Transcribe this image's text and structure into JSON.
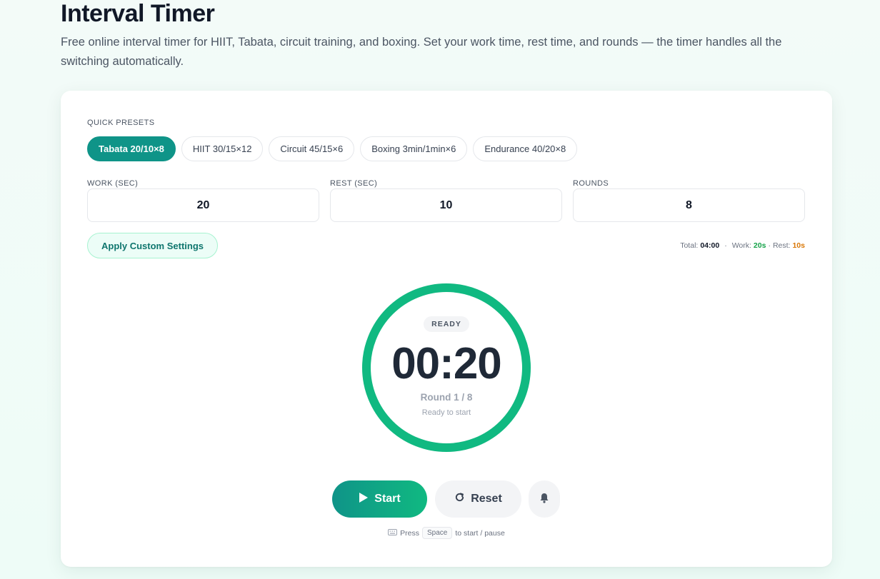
{
  "page": {
    "title": "Interval Timer",
    "description": "Free online interval timer for HIIT, Tabata, circuit training, and boxing. Set your work time, rest time, and rounds — the timer handles all the switching automatically."
  },
  "presets": {
    "label": "QUICK PRESETS",
    "items": [
      {
        "label": "Tabata 20/10×8",
        "active": true
      },
      {
        "label": "HIIT 30/15×12",
        "active": false
      },
      {
        "label": "Circuit 45/15×6",
        "active": false
      },
      {
        "label": "Boxing 3min/1min×6",
        "active": false
      },
      {
        "label": "Endurance 40/20×8",
        "active": false
      }
    ]
  },
  "settings": {
    "work_label": "WORK (SEC)",
    "work_value": "20",
    "rest_label": "REST (SEC)",
    "rest_value": "10",
    "rounds_label": "ROUNDS",
    "rounds_value": "8",
    "apply_label": "Apply Custom Settings"
  },
  "summary": {
    "total_label": "Total:",
    "total_value": "04:00",
    "work_label": "Work:",
    "work_value": "20s",
    "rest_label": "Rest:",
    "rest_value": "10s",
    "separator": "·"
  },
  "timer": {
    "status": "READY",
    "time": "00:20",
    "round": "Round 1 / 8",
    "subtext": "Ready to start",
    "progress": 1.0
  },
  "controls": {
    "start_label": "Start",
    "reset_label": "Reset"
  },
  "hint": {
    "prefix": "Press",
    "key": "Space",
    "suffix": "to start / pause"
  },
  "colors": {
    "accent": "#0f9488",
    "ring": "#10b981",
    "work": "#16a34a",
    "rest": "#d97706"
  },
  "icons": {
    "start": "play-icon",
    "reset": "refresh-icon",
    "bell": "bell-icon",
    "keyboard": "keyboard-icon"
  }
}
